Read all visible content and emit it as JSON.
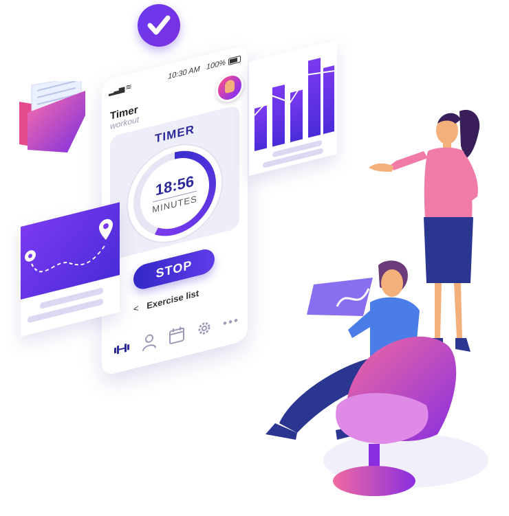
{
  "phone": {
    "status": {
      "time": "10:30 AM",
      "battery": "100%"
    },
    "title": "Timer",
    "subtitle": "workout",
    "timer": {
      "label": "TIMER",
      "value": "18:56",
      "unit": "MINUTES",
      "progress": 0.58
    },
    "stop_label": "STOP",
    "exercise_link": "Exercise list",
    "tabs": [
      {
        "icon": "dumbbell-icon",
        "active": true
      },
      {
        "icon": "user-icon",
        "active": false
      },
      {
        "icon": "calendar-icon",
        "active": false
      },
      {
        "icon": "gear-icon",
        "active": false
      },
      {
        "icon": "more-icon",
        "active": false
      }
    ]
  },
  "colors": {
    "accent": "#3b2fd0",
    "accent_light": "#7b3af0",
    "panel_bg": "#eeeef8",
    "pink": "#f06aa0"
  }
}
